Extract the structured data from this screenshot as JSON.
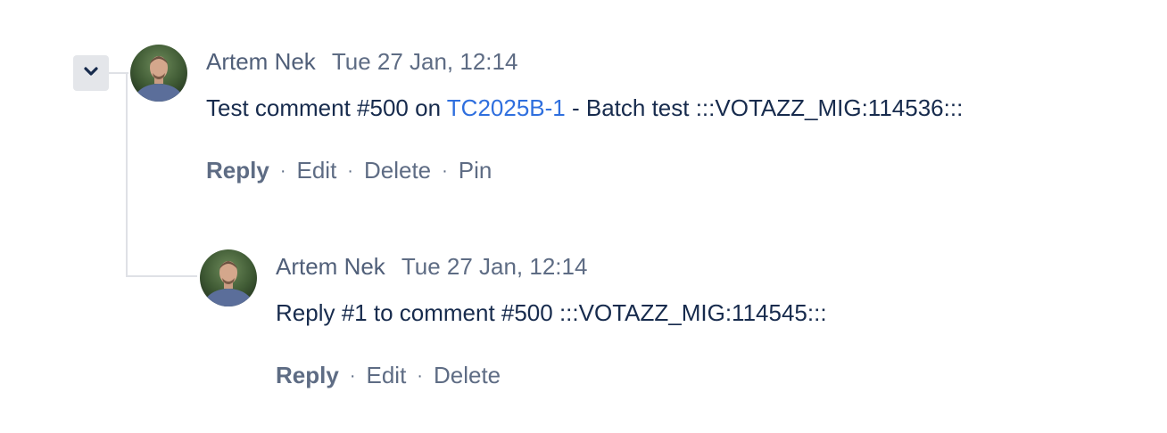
{
  "comments": [
    {
      "author": "Artem Nek",
      "timestamp": "Tue 27 Jan, 12:14",
      "text_before": "Test comment #500 on ",
      "link_text": "TC2025B-1",
      "text_after": " - Batch test :::VOTAZZ_MIG:114536:::",
      "actions": [
        "Reply",
        "Edit",
        "Delete",
        "Pin"
      ]
    }
  ],
  "replies": [
    {
      "author": "Artem Nek",
      "timestamp": "Tue 27 Jan, 12:14",
      "text": "Reply #1 to comment #500 :::VOTAZZ_MIG:114545:::",
      "actions": [
        "Reply",
        "Edit",
        "Delete"
      ]
    }
  ],
  "separator": "·",
  "icons": {
    "collapse": "chevron-down-icon"
  },
  "colors": {
    "link": "#2f6fde",
    "muted": "#5e6c84",
    "text": "#172b4d",
    "toggle_bg": "#e4e6ea"
  }
}
